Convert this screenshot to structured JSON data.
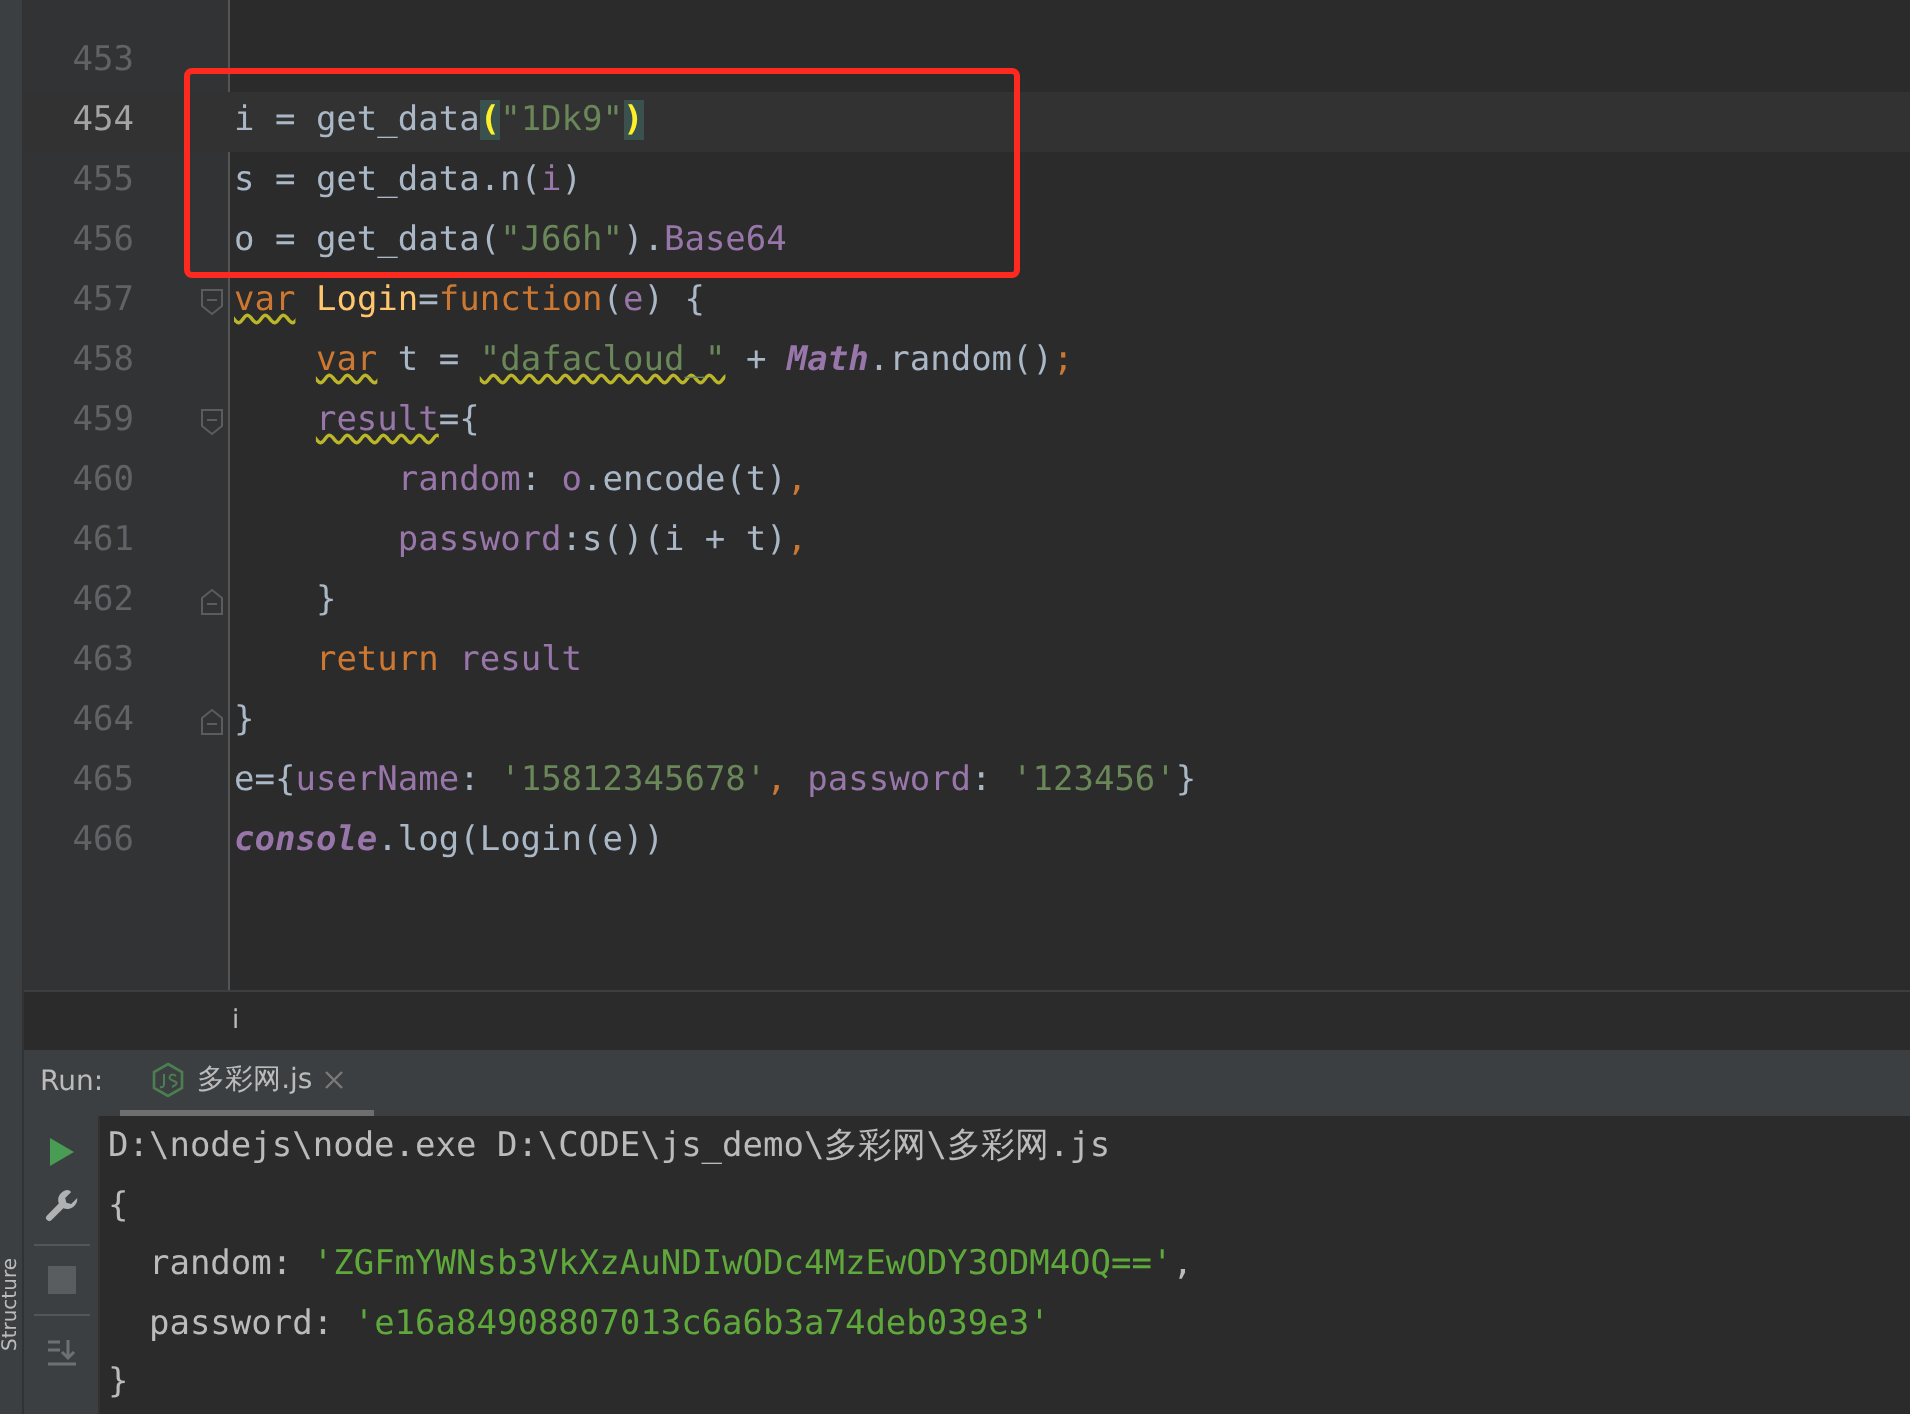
{
  "editor": {
    "blocks": [
      {
        "boxed": false,
        "lines": [
          {
            "number": "453",
            "current": false,
            "kind": "plain"
          }
        ]
      },
      {
        "boxed": true,
        "lines": [
          {
            "number": "454",
            "current": true,
            "kind": "plain",
            "tokens": [
              {
                "text": "i = get_data",
                "kind": "plain"
              },
              {
                "text": "(",
                "kind": "match"
              },
              {
                "text": "\"1Dk9\"",
                "kind": "string"
              },
              {
                "text": ")",
                "kind": "match"
              }
            ]
          },
          {
            "number": "455",
            "current": false,
            "kind": "plain",
            "tokens": [
              {
                "text": "s = get_data.n(",
                "kind": "plain"
              },
              {
                "text": "i",
                "kind": "property"
              },
              {
                "text": ")",
                "kind": "plain"
              }
            ]
          },
          {
            "number": "456",
            "current": false,
            "kind": "plain",
            "tokens": [
              {
                "text": "o = get_data(",
                "kind": "plain"
              },
              {
                "text": "\"J66h\"",
                "kind": "string"
              },
              {
                "text": ").",
                "kind": "plain"
              },
              {
                "text": "Base64",
                "kind": "property"
              }
            ]
          }
        ]
      },
      {
        "boxed": false,
        "lines": [
          {
            "number": "457",
            "current": false,
            "kind": "fold_start",
            "tokens": [
              {
                "text": "var",
                "kind": "keyword_warn"
              },
              {
                "text": " Login",
                "kind": "func"
              },
              {
                "text": "=",
                "kind": "plain"
              },
              {
                "text": "function",
                "kind": "keyword"
              },
              {
                "text": "(",
                "kind": "plain"
              },
              {
                "text": "e",
                "kind": "property"
              },
              {
                "text": ") {",
                "kind": "plain"
              }
            ]
          },
          {
            "number": "458",
            "current": false,
            "kind": "plain",
            "tokens": [
              {
                "text": "    var",
                "kind": "keyword_warn"
              },
              {
                "text": " t = ",
                "kind": "plain"
              },
              {
                "text": "\"dafacloud_\"",
                "kind": "string_warn"
              },
              {
                "text": " + ",
                "kind": "plain"
              },
              {
                "text": "Math",
                "kind": "global"
              },
              {
                "text": ".random()",
                "kind": "plain"
              },
              {
                "text": ";",
                "kind": "keyword"
              }
            ]
          },
          {
            "number": "459",
            "current": false,
            "kind": "fold_start",
            "tokens": [
              {
                "text": "    result",
                "kind": "property_warn"
              },
              {
                "text": "={",
                "kind": "plain"
              }
            ]
          },
          {
            "number": "460",
            "current": false,
            "kind": "plain",
            "tokens": [
              {
                "text": "        random",
                "kind": "property"
              },
              {
                "text": ": ",
                "kind": "plain"
              },
              {
                "text": "o",
                "kind": "property"
              },
              {
                "text": ".encode(t)",
                "kind": "plain"
              },
              {
                "text": ",",
                "kind": "keyword"
              }
            ]
          },
          {
            "number": "461",
            "current": false,
            "kind": "plain",
            "tokens": [
              {
                "text": "        password",
                "kind": "property"
              },
              {
                "text": ":s()(i + t)",
                "kind": "plain"
              },
              {
                "text": ",",
                "kind": "keyword"
              }
            ]
          },
          {
            "number": "462",
            "current": false,
            "kind": "fold_end",
            "tokens": [
              {
                "text": "    }",
                "kind": "plain"
              }
            ]
          },
          {
            "number": "463",
            "current": false,
            "kind": "plain",
            "tokens": [
              {
                "text": "    return",
                "kind": "keyword"
              },
              {
                "text": " result",
                "kind": "property"
              }
            ]
          },
          {
            "number": "464",
            "current": false,
            "kind": "fold_end",
            "tokens": [
              {
                "text": "}",
                "kind": "plain"
              }
            ]
          },
          {
            "number": "465",
            "current": false,
            "kind": "plain",
            "tokens": [
              {
                "text": "e={",
                "kind": "plain"
              },
              {
                "text": "userName",
                "kind": "property"
              },
              {
                "text": ": ",
                "kind": "plain"
              },
              {
                "text": "'15812345678'",
                "kind": "string"
              },
              {
                "text": ", ",
                "kind": "keyword"
              },
              {
                "text": "password",
                "kind": "property"
              },
              {
                "text": ": ",
                "kind": "plain"
              },
              {
                "text": "'123456'",
                "kind": "string"
              },
              {
                "text": "}",
                "kind": "plain"
              }
            ]
          },
          {
            "number": "466",
            "current": false,
            "kind": "plain",
            "tokens": [
              {
                "text": "console",
                "kind": "global"
              },
              {
                "text": ".log(Login(e))",
                "kind": "plain"
              }
            ]
          }
        ]
      }
    ]
  },
  "breadcrumb": "i",
  "run_panel": {
    "label": "Run:",
    "tabs": [
      {
        "label": "多彩网.js",
        "selected": true
      }
    ],
    "side_label": "Structure",
    "console": [
      {
        "tokens": [
          {
            "text": "D:\\nodejs\\node.exe D:\\CODE\\js_demo\\多彩网\\多彩网.js",
            "kind": "plain"
          }
        ]
      },
      {
        "tokens": [
          {
            "text": "{",
            "kind": "plain"
          }
        ]
      },
      {
        "tokens": [
          {
            "text": "  random: ",
            "kind": "plain"
          },
          {
            "text": "'ZGFmYWNsb3VkXzAuNDIwODc4MzEwODY3ODM4OQ=='",
            "kind": "string"
          },
          {
            "text": ",",
            "kind": "plain"
          }
        ]
      },
      {
        "tokens": [
          {
            "text": "  password: ",
            "kind": "plain"
          },
          {
            "text": "'e16a84908807013c6a6b3a74deb039e3'",
            "kind": "string"
          }
        ]
      },
      {
        "tokens": [
          {
            "text": "}",
            "kind": "plain"
          }
        ]
      }
    ]
  }
}
